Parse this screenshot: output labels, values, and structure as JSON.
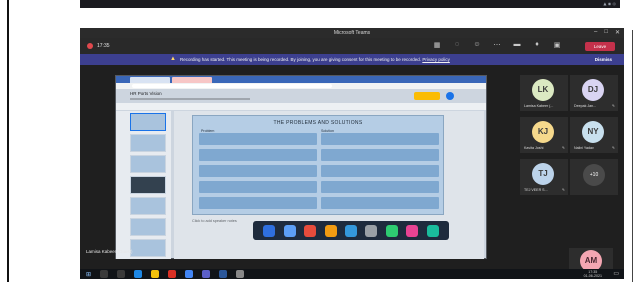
{
  "window": {
    "title": "Microsoft Teams",
    "controls": [
      "–",
      "□",
      "✕"
    ]
  },
  "meeting": {
    "timer": "17:35",
    "leave_label": "Leave",
    "toolbar_icons": [
      "grid-icon",
      "chat-icon",
      "people-icon",
      "more-icon",
      "camera-icon",
      "mic-icon",
      "share-icon"
    ]
  },
  "banner": {
    "text": "Recording has started. This meeting is being recorded. By joining, you are giving consent for this meeting to be recorded.",
    "link": "Privacy policy",
    "dismiss": "Dismiss"
  },
  "shared_screen": {
    "deck_title": "HR Ports Vision",
    "slide_title": "THE PROBLEMS AND SOLUTIONS",
    "column_left": "Problem",
    "column_right": "Solution",
    "speaker_notes": "Click to add speaker notes",
    "presenter_name": "Lamisa Kabeer (Guest)"
  },
  "participants": [
    {
      "initials": "LK",
      "name": "Lamisa Kabeer (...",
      "color": "#dbe9c2"
    },
    {
      "initials": "DJ",
      "name": "Deepak Jan...",
      "color": "#d9d4f2"
    },
    {
      "initials": "KJ",
      "name": "Kavita Joshi",
      "color": "#f6d98c"
    },
    {
      "initials": "NY",
      "name": "Nalini Yadav",
      "color": "#c8e0ee"
    },
    {
      "initials": "TJ",
      "name": "TEJ VEER S...",
      "color": "#bcd3ea"
    }
  ],
  "more_participants": "+10",
  "self_view": {
    "initials": "AM",
    "color": "#f4a6b2"
  },
  "taskbar": {
    "tray_time": "17:35",
    "tray_date": "01-06-2021"
  },
  "colors": {
    "leave": "#c4314b",
    "banner": "#3c3f8f",
    "app_bg": "#1f1f1f"
  }
}
